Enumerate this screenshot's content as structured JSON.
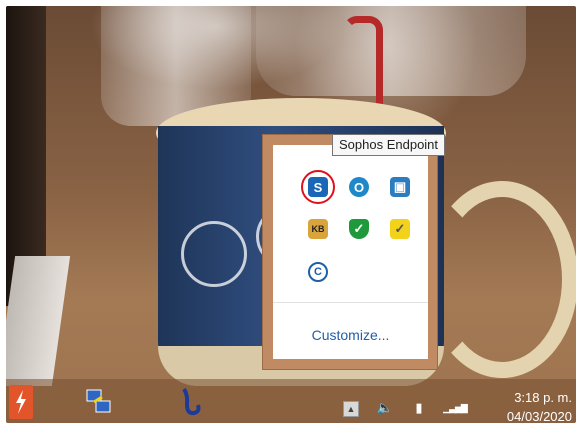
{
  "tooltip": {
    "text": "Sophos Endpoint"
  },
  "tray": {
    "icons": [
      {
        "name": "sophos-endpoint-icon",
        "glyph": "S",
        "color": "#1a67b8"
      },
      {
        "name": "circular-sync-icon",
        "glyph": "O",
        "color": "#1e88c8"
      },
      {
        "name": "network-monitor-icon",
        "glyph": "▣",
        "color": "#2b7dbf"
      },
      {
        "name": "kb-folder-icon",
        "glyph": "KB",
        "color": "#d9a43c"
      },
      {
        "name": "green-shield-icon",
        "glyph": "✓",
        "color": "#1e9a3c"
      },
      {
        "name": "yellow-checkmark-icon",
        "glyph": "✓",
        "color": "#f2d21b"
      },
      {
        "name": "copyright-c-icon",
        "glyph": "C",
        "color": "#1f5fa8"
      }
    ],
    "customize_label": "Customize..."
  },
  "taskbar": {
    "apps": [
      {
        "name": "red-lightning-app-icon"
      },
      {
        "name": "network-computers-app-icon"
      },
      {
        "name": "saxophone-app-icon"
      }
    ],
    "system": {
      "show_hidden_glyph": "▲",
      "volume_glyph": "🔈",
      "battery_glyph": "▮",
      "signal_glyph": "▁▃▅▇"
    },
    "clock": {
      "time": "3:18 p. m.",
      "date": "04/03/2020"
    }
  }
}
